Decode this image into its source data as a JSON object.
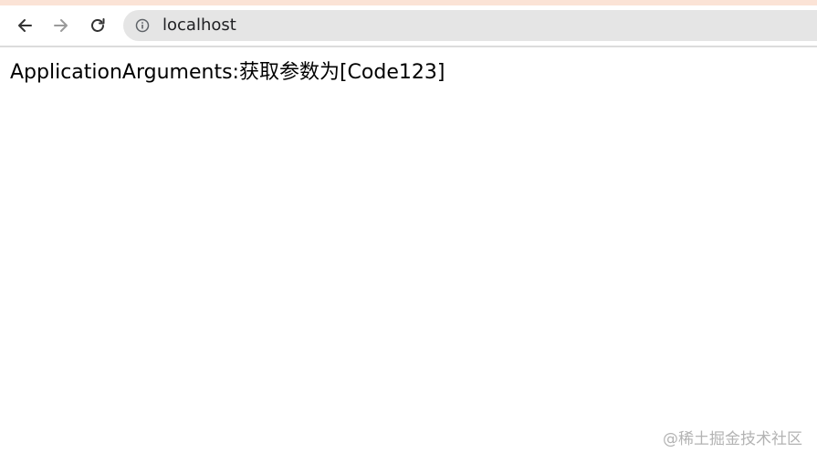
{
  "browser": {
    "url": "localhost",
    "icons": {
      "back": "back-arrow-icon",
      "forward": "forward-arrow-icon",
      "reload": "reload-icon",
      "site_info": "info-icon"
    }
  },
  "page": {
    "body_text": "ApplicationArguments:获取参数为[Code123]"
  },
  "watermark": {
    "text": "@稀土掘金技术社区"
  },
  "colors": {
    "top_strip": "#fbe3d6",
    "omnibox_bg": "#e5e5e5",
    "watermark": "#b3b3b3"
  }
}
